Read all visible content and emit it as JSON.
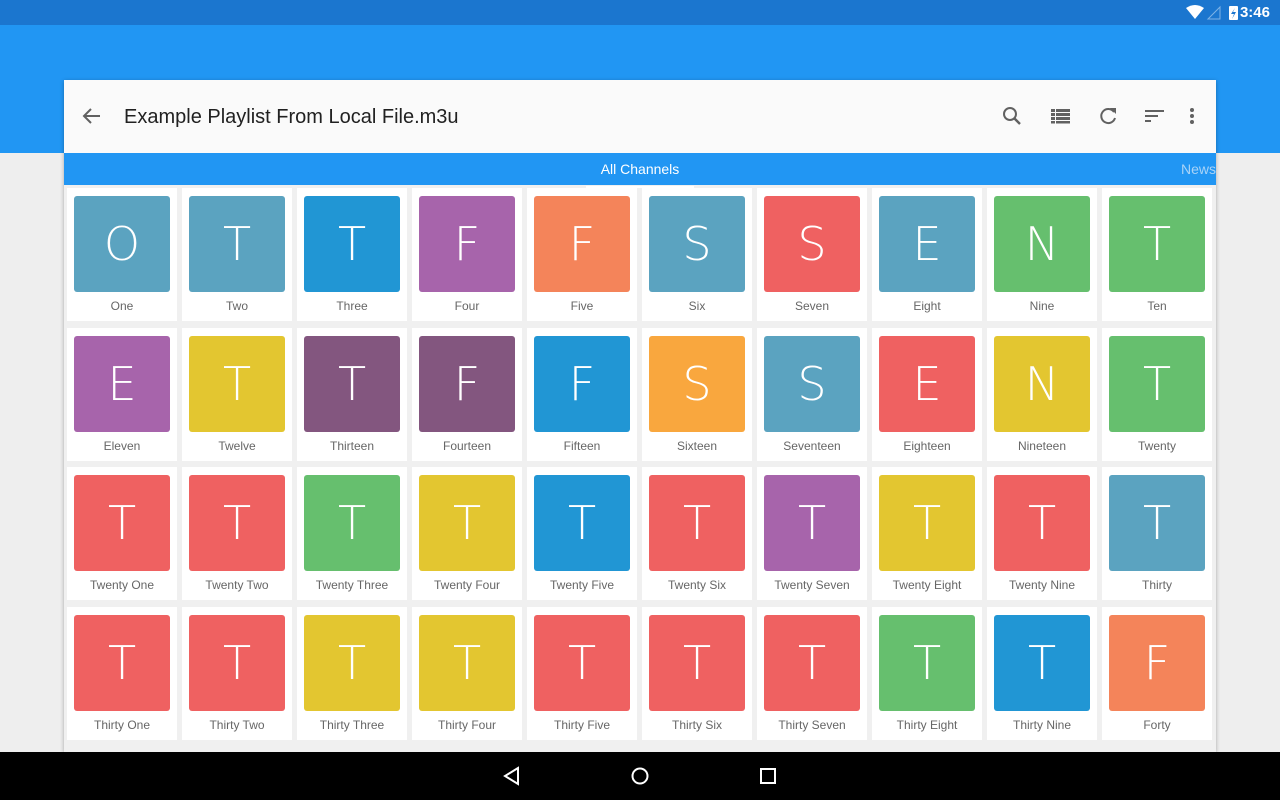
{
  "status_bar": {
    "time": "3:46",
    "icons": [
      "wifi-icon",
      "signal-icon",
      "battery-charging-icon"
    ]
  },
  "toolbar": {
    "title": "Example Playlist From Local File.m3u",
    "icons": [
      "back-arrow-icon",
      "search-icon",
      "list-view-icon",
      "refresh-icon",
      "sort-icon",
      "more-vert-icon"
    ]
  },
  "tabs": [
    {
      "label": "All Channels",
      "selected": true
    },
    {
      "label": "News",
      "selected": false
    }
  ],
  "colors": {
    "primary": "#2196f3",
    "status": "#1b76cf"
  },
  "channels": [
    {
      "name": "One",
      "letter": "O",
      "color": "#5ba3c0"
    },
    {
      "name": "Two",
      "letter": "T",
      "color": "#5ba3c0"
    },
    {
      "name": "Three",
      "letter": "T",
      "color": "#2196d4"
    },
    {
      "name": "Four",
      "letter": "F",
      "color": "#a764ab"
    },
    {
      "name": "Five",
      "letter": "F",
      "color": "#f4845a"
    },
    {
      "name": "Six",
      "letter": "S",
      "color": "#5ba3c0"
    },
    {
      "name": "Seven",
      "letter": "S",
      "color": "#ef6161"
    },
    {
      "name": "Eight",
      "letter": "E",
      "color": "#5ba3c0"
    },
    {
      "name": "Nine",
      "letter": "N",
      "color": "#66bf6e"
    },
    {
      "name": "Ten",
      "letter": "T",
      "color": "#66bf6e"
    },
    {
      "name": "Eleven",
      "letter": "E",
      "color": "#a764ab"
    },
    {
      "name": "Twelve",
      "letter": "T",
      "color": "#e3c630"
    },
    {
      "name": "Thirteen",
      "letter": "T",
      "color": "#83567f"
    },
    {
      "name": "Fourteen",
      "letter": "F",
      "color": "#83567f"
    },
    {
      "name": "Fifteen",
      "letter": "F",
      "color": "#2196d4"
    },
    {
      "name": "Sixteen",
      "letter": "S",
      "color": "#f9a73e"
    },
    {
      "name": "Seventeen",
      "letter": "S",
      "color": "#5ba3c0"
    },
    {
      "name": "Eighteen",
      "letter": "E",
      "color": "#ef6161"
    },
    {
      "name": "Nineteen",
      "letter": "N",
      "color": "#e3c630"
    },
    {
      "name": "Twenty",
      "letter": "T",
      "color": "#66bf6e"
    },
    {
      "name": "Twenty One",
      "letter": "T",
      "color": "#ef6161"
    },
    {
      "name": "Twenty Two",
      "letter": "T",
      "color": "#ef6161"
    },
    {
      "name": "Twenty Three",
      "letter": "T",
      "color": "#66bf6e"
    },
    {
      "name": "Twenty Four",
      "letter": "T",
      "color": "#e3c630"
    },
    {
      "name": "Twenty Five",
      "letter": "T",
      "color": "#2196d4"
    },
    {
      "name": "Twenty Six",
      "letter": "T",
      "color": "#ef6161"
    },
    {
      "name": "Twenty Seven",
      "letter": "T",
      "color": "#a764ab"
    },
    {
      "name": "Twenty Eight",
      "letter": "T",
      "color": "#e3c630"
    },
    {
      "name": "Twenty Nine",
      "letter": "T",
      "color": "#ef6161"
    },
    {
      "name": "Thirty",
      "letter": "T",
      "color": "#5ba3c0"
    },
    {
      "name": "Thirty One",
      "letter": "T",
      "color": "#ef6161"
    },
    {
      "name": "Thirty Two",
      "letter": "T",
      "color": "#ef6161"
    },
    {
      "name": "Thirty Three",
      "letter": "T",
      "color": "#e3c630"
    },
    {
      "name": "Thirty Four",
      "letter": "T",
      "color": "#e3c630"
    },
    {
      "name": "Thirty Five",
      "letter": "T",
      "color": "#ef6161"
    },
    {
      "name": "Thirty Six",
      "letter": "T",
      "color": "#ef6161"
    },
    {
      "name": "Thirty Seven",
      "letter": "T",
      "color": "#ef6161"
    },
    {
      "name": "Thirty Eight",
      "letter": "T",
      "color": "#66bf6e"
    },
    {
      "name": "Thirty Nine",
      "letter": "T",
      "color": "#2196d4"
    },
    {
      "name": "Forty",
      "letter": "F",
      "color": "#f4845a"
    }
  ],
  "nav_bar": {
    "icons": [
      "back-triangle-icon",
      "home-circle-icon",
      "recents-square-icon"
    ]
  }
}
